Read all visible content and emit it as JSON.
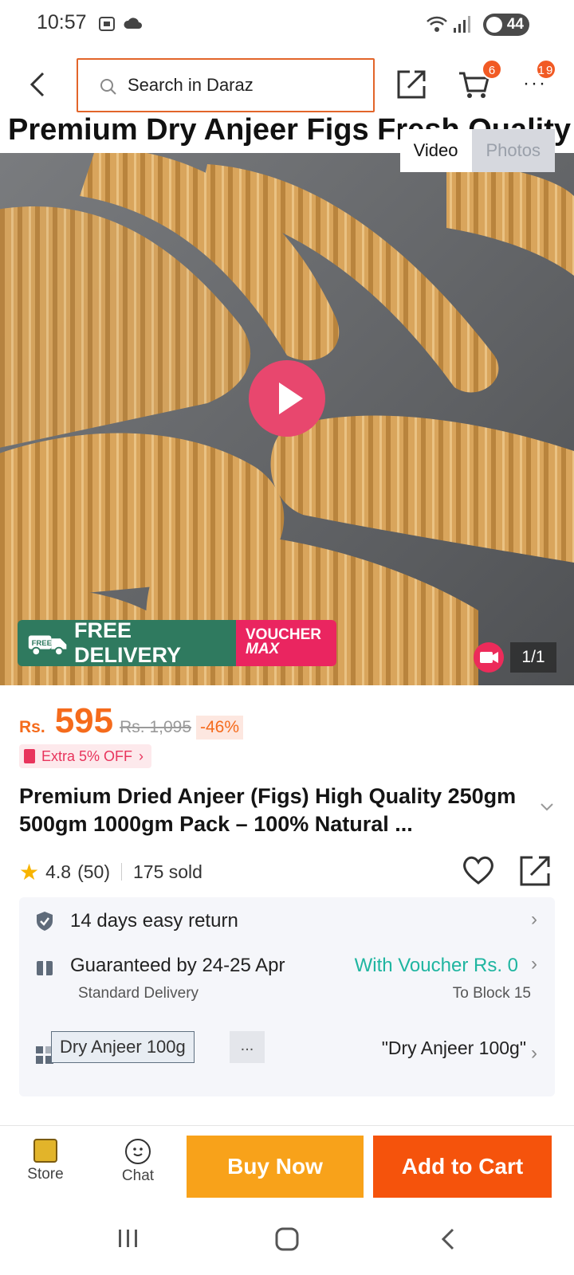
{
  "status_bar": {
    "time": "10:57",
    "battery": "44"
  },
  "top_nav": {
    "search_placeholder": "Search in Daraz",
    "cart_badge": "6",
    "more_badge": "19"
  },
  "hero": {
    "title_text": "Premium Dry Anjeer Figs Fresh Quality",
    "toggle_video": "Video",
    "toggle_photos": "Photos",
    "free_delivery": "FREE DELIVERY",
    "free_tag": "FREE",
    "voucher_line1": "VOUCHER",
    "voucher_line2": "MAX",
    "counter": "1/1"
  },
  "price": {
    "currency": "Rs.",
    "value": "595",
    "old": "Rs. 1,095",
    "discount": "-46%",
    "extra_off": "Extra 5% OFF"
  },
  "product": {
    "title": "Premium Dried Anjeer (Figs) High Quality 250gm 500gm 1000gm Pack – 100% Natural ...",
    "rating": "4.8",
    "rating_count": "(50)",
    "sold": "175 sold"
  },
  "info": {
    "return": "14 days easy return",
    "delivery": "Guaranteed by 24-25 Apr",
    "delivery_sub": "Standard Delivery",
    "voucher": "With Voucher Rs. 0",
    "to_block": "To Block 15",
    "variant_chip": "Dry Anjeer 100g",
    "variant_more": "...",
    "variant_selected": "\"Dry Anjeer 100g\""
  },
  "bottom_bar": {
    "store": "Store",
    "chat": "Chat",
    "buy_now": "Buy Now",
    "add_to_cart": "Add to Cart"
  },
  "colors": {
    "accent": "#f56b1c",
    "buy_now": "#f8a21a",
    "add_to_cart": "#f5530c",
    "voucher_green": "#1fb5a0"
  }
}
